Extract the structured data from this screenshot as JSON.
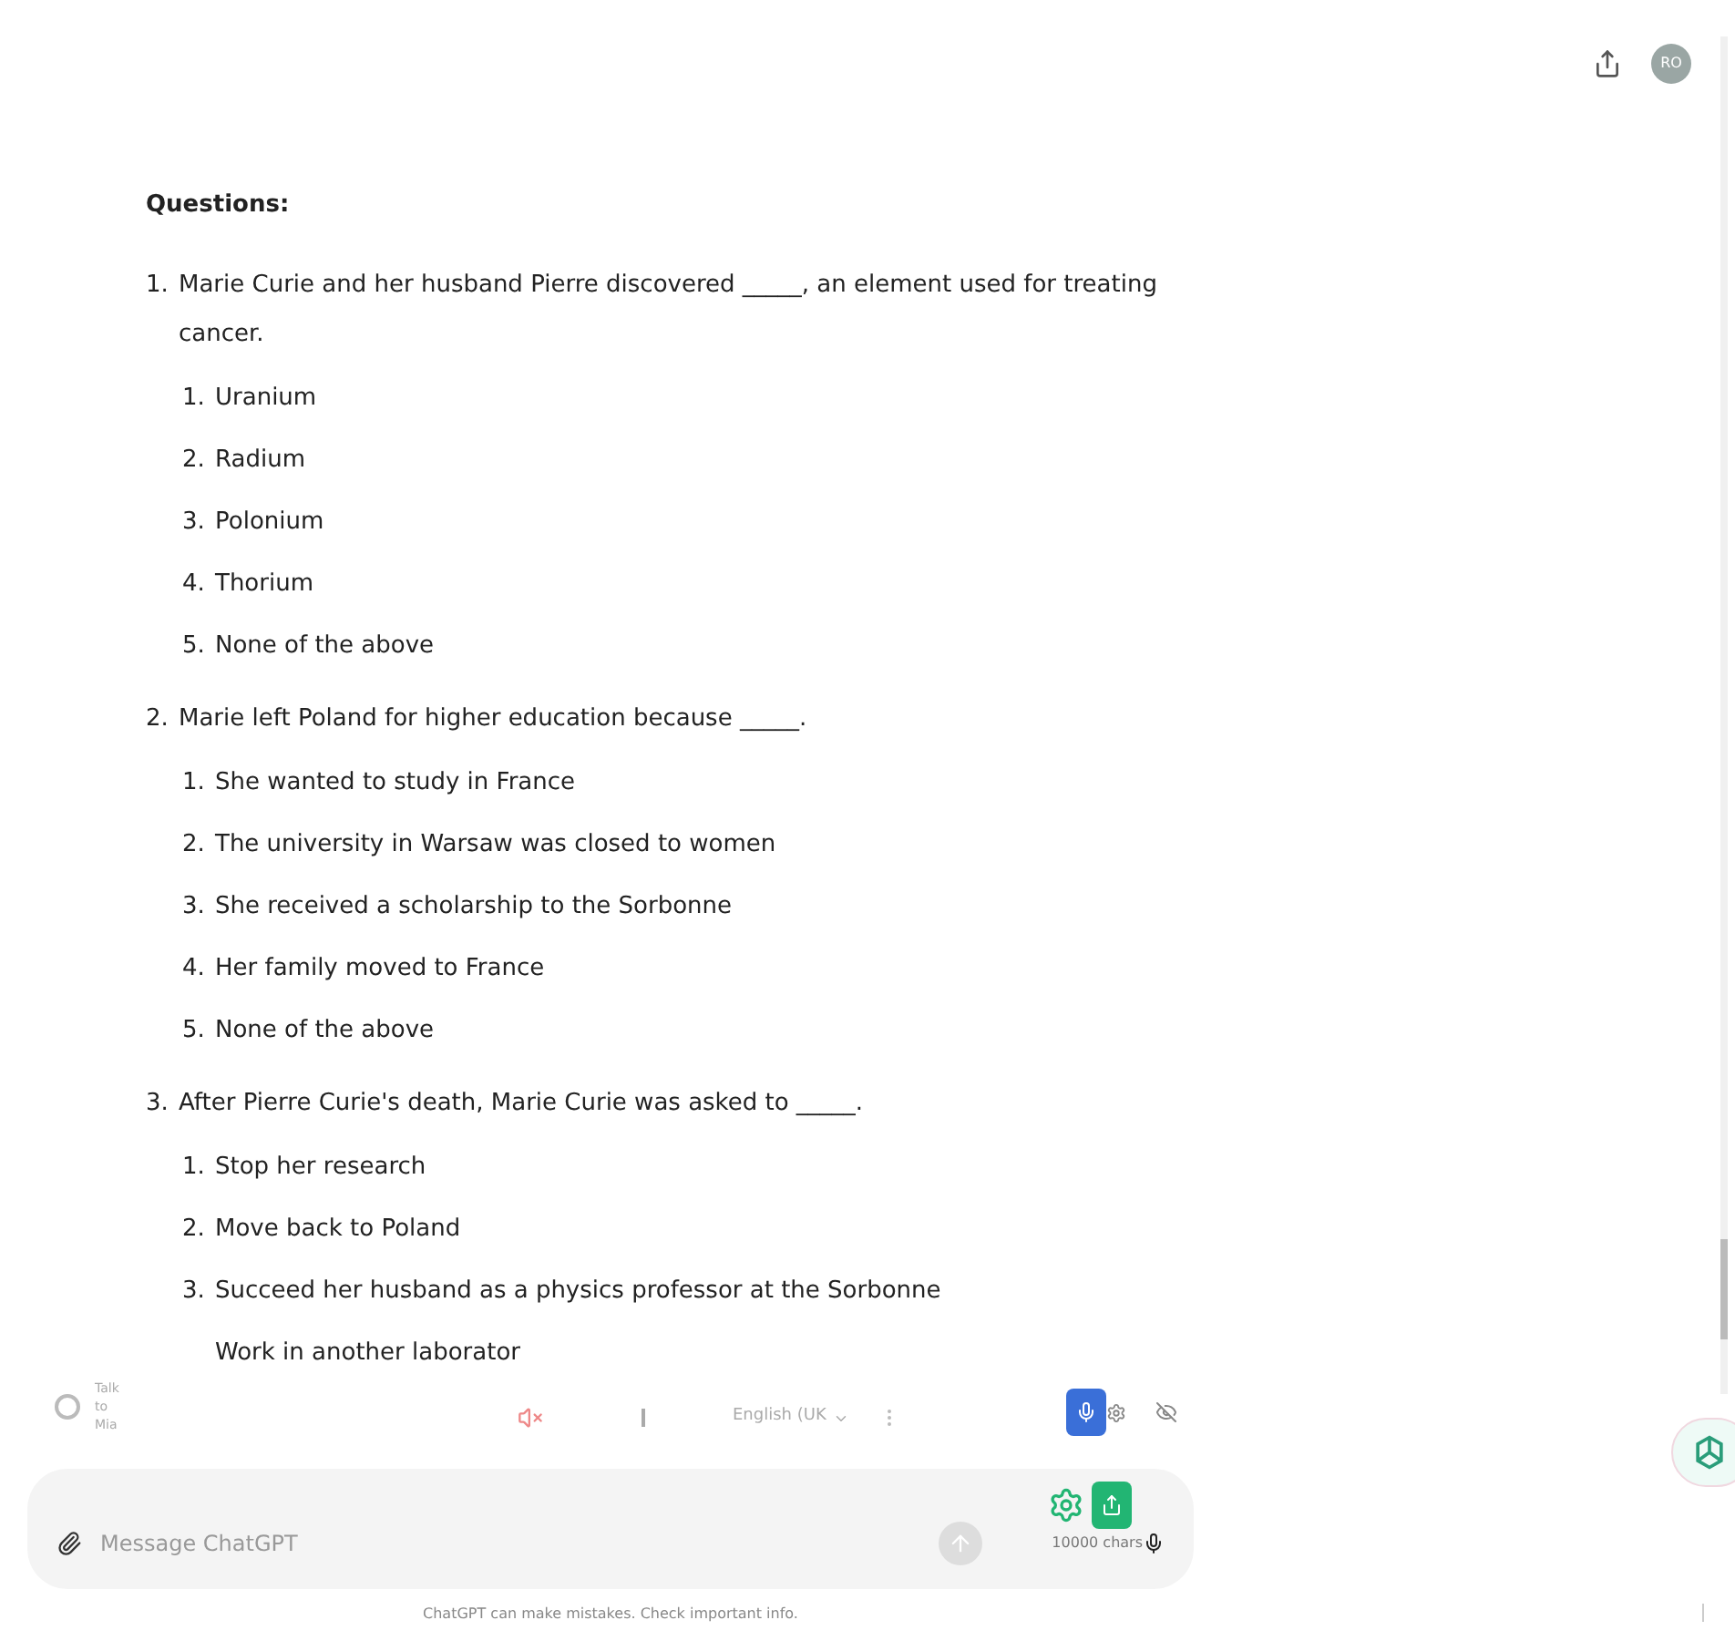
{
  "header": {
    "avatar": "RO"
  },
  "heading": "Questions:",
  "questions": [
    {
      "number": "1.",
      "text": "Marie Curie and her husband Pierre discovered _____, an element used for treating cancer.",
      "options": [
        {
          "number": "1.",
          "text": "Uranium"
        },
        {
          "number": "2.",
          "text": "Radium"
        },
        {
          "number": "3.",
          "text": "Polonium"
        },
        {
          "number": "4.",
          "text": "Thorium"
        },
        {
          "number": "5.",
          "text": "None of the above"
        }
      ]
    },
    {
      "number": "2.",
      "text": "Marie left Poland for higher education because _____.",
      "options": [
        {
          "number": "1.",
          "text": "She wanted to study in France"
        },
        {
          "number": "2.",
          "text": "The university in Warsaw was closed to women"
        },
        {
          "number": "3.",
          "text": "She received a scholarship to the Sorbonne"
        },
        {
          "number": "4.",
          "text": "Her family moved to France"
        },
        {
          "number": "5.",
          "text": "None of the above"
        }
      ]
    },
    {
      "number": "3.",
      "text": "After Pierre Curie's death, Marie Curie was asked to _____.",
      "options": [
        {
          "number": "1.",
          "text": "Stop her research"
        },
        {
          "number": "2.",
          "text": "Move back to Poland"
        },
        {
          "number": "3.",
          "text": "Succeed her husband as a physics professor at the Sorbonne"
        },
        {
          "text": "Work in another laborator"
        }
      ]
    }
  ],
  "voice_bar": {
    "label": "Talk to Mia",
    "language": "English (UK"
  },
  "composer": {
    "placeholder": "Message ChatGPT",
    "char_count": "10000 chars"
  },
  "footer": "ChatGPT can make mistakes. Check important info."
}
